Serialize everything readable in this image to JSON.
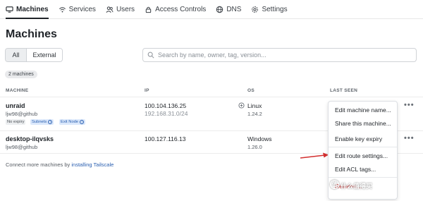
{
  "nav": {
    "items": [
      {
        "label": "Machines",
        "icon": "machines-icon",
        "active": true
      },
      {
        "label": "Services",
        "icon": "wifi-icon"
      },
      {
        "label": "Users",
        "icon": "users-icon"
      },
      {
        "label": "Access Controls",
        "icon": "lock-icon"
      },
      {
        "label": "DNS",
        "icon": "globe-icon"
      },
      {
        "label": "Settings",
        "icon": "gear-icon"
      }
    ]
  },
  "page": {
    "title": "Machines"
  },
  "filter": {
    "all_label": "All",
    "external_label": "External"
  },
  "search": {
    "placeholder": "Search by name, owner, tag, version..."
  },
  "count_badge": "2 machines",
  "table": {
    "headers": {
      "machine": "MACHINE",
      "ip": "IP",
      "os": "OS",
      "last_seen": "LAST SEEN"
    },
    "rows": [
      {
        "name": "unraid",
        "owner": "ljw98@github",
        "tags": [
          "No expiry",
          "Subnets",
          "Exit Node"
        ],
        "ip": "100.104.136.25",
        "ip_sub": "192.168.31.0/24",
        "os": "Linux",
        "os_version": "1.24.2",
        "more": "•••"
      },
      {
        "name": "desktop-ilqvsks",
        "owner": "ljw98@github",
        "ip": "100.127.116.13",
        "os": "Windows",
        "os_version": "1.26.0",
        "more": "•••"
      }
    ]
  },
  "footer": {
    "prefix": "Connect more machines by ",
    "link": "installing Tailscale"
  },
  "context_menu": {
    "items": [
      "Edit machine name...",
      "Share this machine...",
      "Enable key expiry",
      "Edit route settings...",
      "Edit ACL tags...",
      "Remove..."
    ]
  },
  "annotation": {
    "arrow_color": "#d32f2f"
  },
  "watermark": {
    "logo": "值",
    "text": "什么值得买"
  },
  "colors": {
    "accent": "#2a5fb0",
    "tag_blue_bg": "#dbe8fb",
    "danger": "#c62828"
  }
}
